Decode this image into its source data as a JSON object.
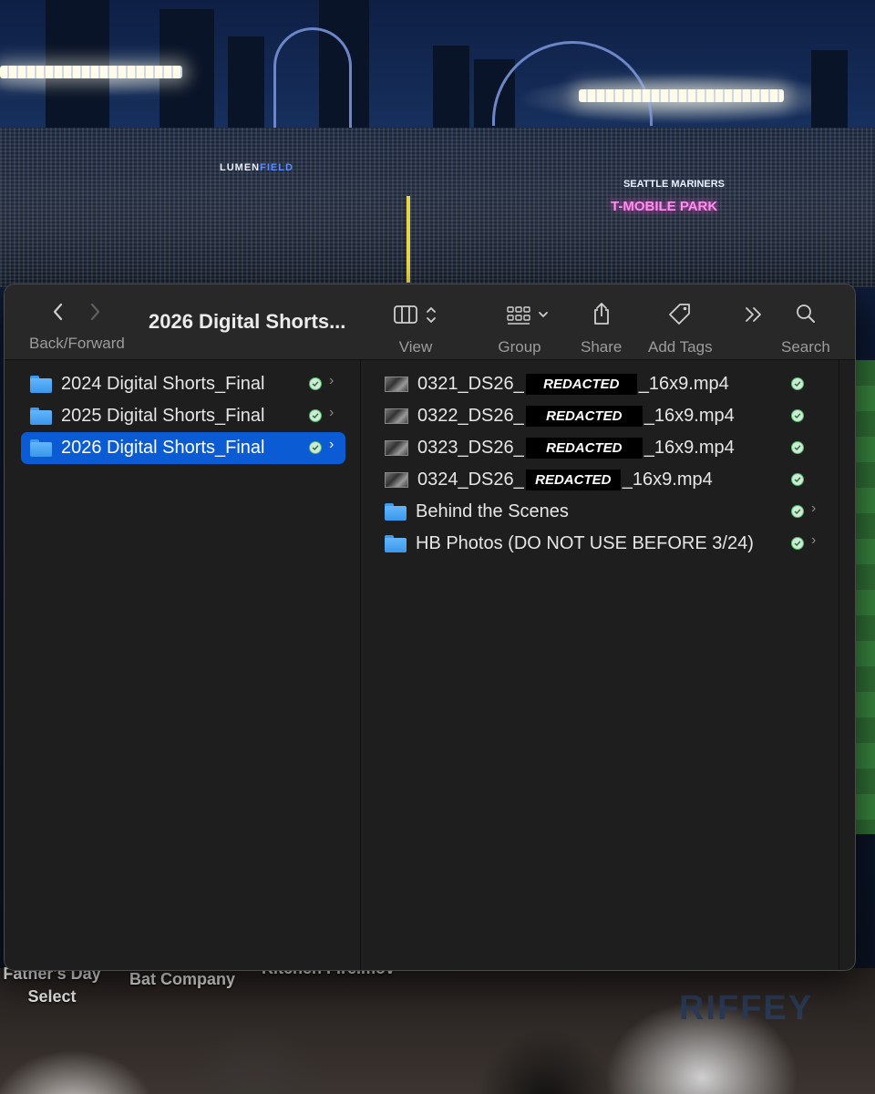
{
  "window": {
    "title": "2026 Digital Shorts..."
  },
  "toolbar": {
    "back_forward_label": "Back/Forward",
    "view_label": "View",
    "group_label": "Group",
    "share_label": "Share",
    "add_tags_label": "Add Tags",
    "search_label": "Search"
  },
  "sidebar": {
    "items": [
      {
        "label": "2024 Digital Shorts_Final",
        "selected": false
      },
      {
        "label": "2025 Digital Shorts_Final",
        "selected": false
      },
      {
        "label": "2026 Digital Shorts_Final",
        "selected": true
      }
    ]
  },
  "files": [
    {
      "prefix": "0321_DS26_",
      "redacted": "REDACTED",
      "suffix": "_16x9.mp4",
      "kind": "video"
    },
    {
      "prefix": "0322_DS26_",
      "redacted": "REDACTED",
      "suffix": "_16x9.mp4",
      "kind": "video"
    },
    {
      "prefix": "0323_DS26_",
      "redacted": "REDACTED",
      "suffix": "_16x9.mp4",
      "kind": "video"
    },
    {
      "prefix": "0324_DS26_",
      "redacted": "REDACTED",
      "suffix": "_16x9.mp4",
      "kind": "video"
    },
    {
      "name": "Behind the Scenes",
      "kind": "folder"
    },
    {
      "name": "HB Photos (DO NOT USE BEFORE 3/24)",
      "kind": "folder"
    }
  ],
  "desktop": {
    "labels": [
      "Father's Day\nSelect",
      "Bat Company",
      "Kitchen Fire.mov"
    ]
  },
  "wallpaper": {
    "signs": {
      "lumen": "LUMEN",
      "lumen_field": "FIELD",
      "park": "T-MOBILE PARK",
      "team": "SEATTLE MARINERS"
    },
    "jersey": "RIFFEY"
  },
  "colors": {
    "selection": "#0a5bd4",
    "folder": "#4aa8f5",
    "sync_ok": "#4dbb6a"
  }
}
